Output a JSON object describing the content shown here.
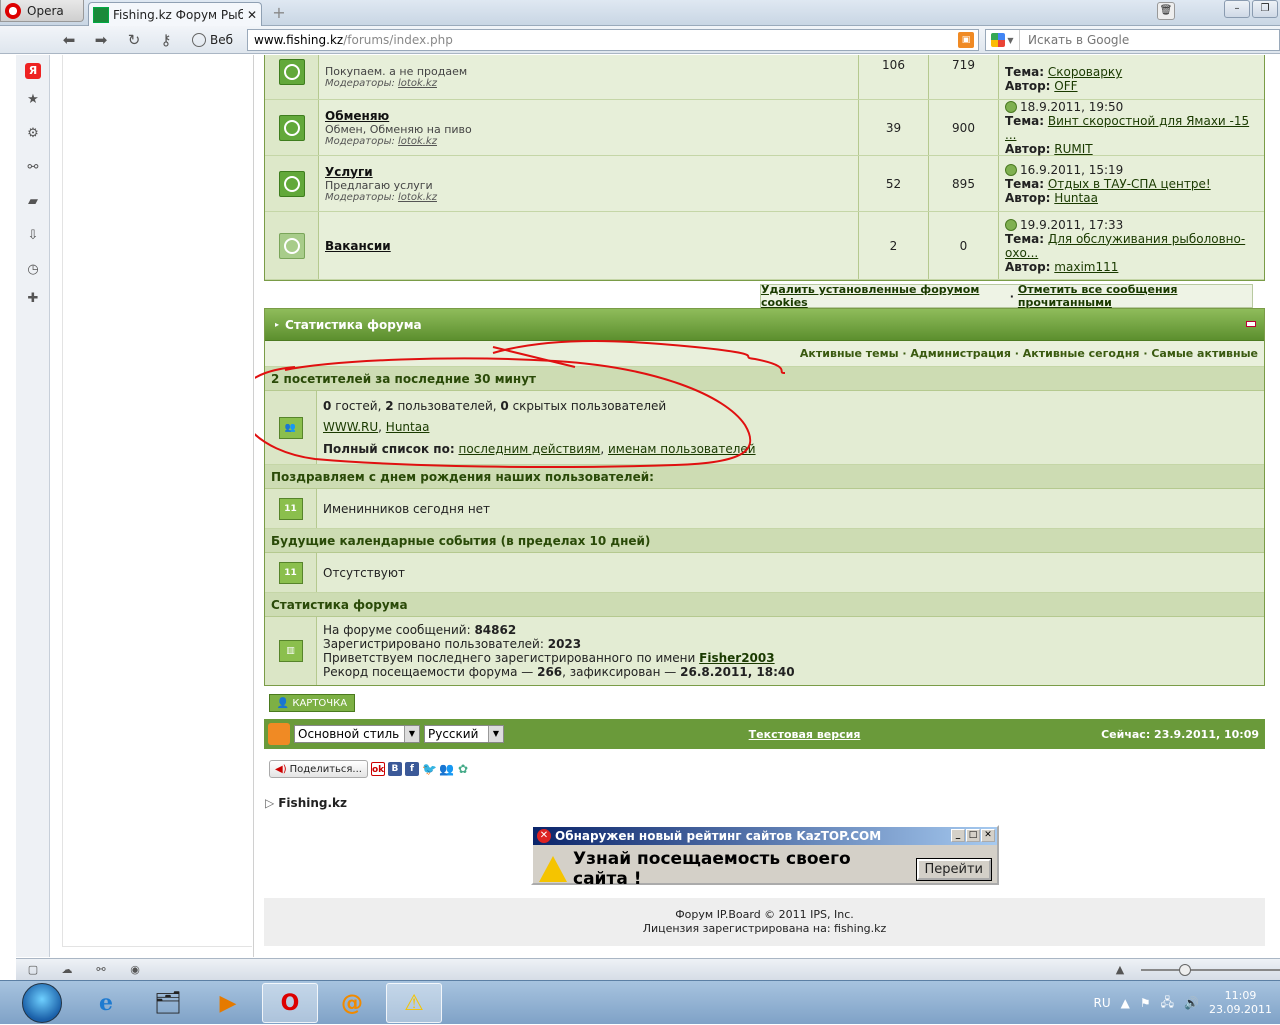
{
  "browser": {
    "app_name": "Opera",
    "tab_title": "Fishing.kz Форум Рыб...",
    "web_label": "Веб",
    "url_host": "www.fishing.kz",
    "url_path": "/forums/index.php",
    "search_placeholder": "Искать в Google"
  },
  "forums": [
    {
      "title": "",
      "desc": "Покупаем. а не продаем",
      "mods_label": "Модераторы:",
      "mod": "lotok.kz",
      "topics": "106",
      "posts": "719",
      "last_date": "",
      "topic_label": "Тема:",
      "last_topic": "Скороварку",
      "author_label": "Автор:",
      "last_author": "OFF"
    },
    {
      "title": "Обменяю",
      "desc": "Обмен, Обменяю на пиво",
      "mods_label": "Модераторы:",
      "mod": "lotok.kz",
      "topics": "39",
      "posts": "900",
      "last_date": "18.9.2011, 19:50",
      "topic_label": "Тема:",
      "last_topic": "Винт скоростной для Ямахи -15 ...",
      "author_label": "Автор:",
      "last_author": "RUMIT"
    },
    {
      "title": "Услуги",
      "desc": "Предлагаю услуги",
      "mods_label": "Модераторы:",
      "mod": "lotok.kz",
      "topics": "52",
      "posts": "895",
      "last_date": "16.9.2011, 15:19",
      "topic_label": "Тема:",
      "last_topic": "Отдых в ТАУ-СПА центре!",
      "author_label": "Автор:",
      "last_author": "Huntaa"
    },
    {
      "title": "Вакансии",
      "desc": "",
      "mods_label": "",
      "mod": "",
      "topics": "2",
      "posts": "0",
      "last_date": "19.9.2011, 17:33",
      "topic_label": "Тема:",
      "last_topic": "Для обслуживания рыболовно-охо...",
      "author_label": "Автор:",
      "last_author": "maxim111"
    }
  ],
  "cookies": {
    "delete": "Удалить установленные форумом cookies",
    "sep": "·",
    "mark_read": "Отметить все сообщения прочитанными"
  },
  "stats": {
    "title": "Статистика форума",
    "links": [
      "Активные темы",
      "Администрация",
      "Активные сегодня",
      "Самые активные"
    ],
    "online_head": "2 посетителей за последние 30 минут",
    "online_summary": {
      "guests_n": "0",
      "guests": "гостей,",
      "users_n": "2",
      "users": "пользователей,",
      "hidden_n": "0",
      "hidden": "скрытых пользователей"
    },
    "online_users": [
      "WWW.RU",
      "Huntaa"
    ],
    "full_list_label": "Полный список по:",
    "full_list_links": [
      "последним действиям",
      "именам пользователей"
    ],
    "birthday_head": "Поздравляем с днем рождения наших пользователей:",
    "birthday_text": "Именинников сегодня нет",
    "events_head": "Будущие календарные события (в пределах 10 дней)",
    "events_text": "Отсутствуют",
    "forum_stats_head": "Статистика форума",
    "posts_label": "На форуме сообщений:",
    "posts_value": "84862",
    "registered_label": "Зарегистрировано пользователей:",
    "registered_value": "2023",
    "last_member_label": "Приветствуем последнего зарегистрированного по имени",
    "last_member": "Fisher2003",
    "record_label": "Рекорд посещаемости форума —",
    "record_value": "266",
    "record_mid": ", зафиксирован —",
    "record_date": "26.8.2011, 18:40",
    "calendar_icon_text": "11"
  },
  "card_button": "КАРТОЧКА",
  "footer": {
    "style_select": "Основной стиль",
    "lang_select": "Русский",
    "text_version": "Текстовая версия",
    "now": "Сейчас: 23.9.2011, 10:09"
  },
  "share_button": "Поделиться...",
  "breadcrumb": "Fishing.kz",
  "kaztop": {
    "title": "Обнаружен новый рейтинг сайтов KazTOP.COM",
    "message": "Узнай посещаемость своего сайта !",
    "go": "Перейти"
  },
  "copyright": {
    "line1": "Форум IP.Board © 2011  IPS, Inc.",
    "line2": "Лицензия зарегистрирована на: fishing.kz"
  },
  "taskbar": {
    "lang": "RU",
    "time": "11:09",
    "date": "23.09.2011"
  },
  "colors": {
    "forum_green": "#6a9a3a",
    "panel_bg": "#e3ecd3",
    "annotation_red": "#e01010"
  }
}
